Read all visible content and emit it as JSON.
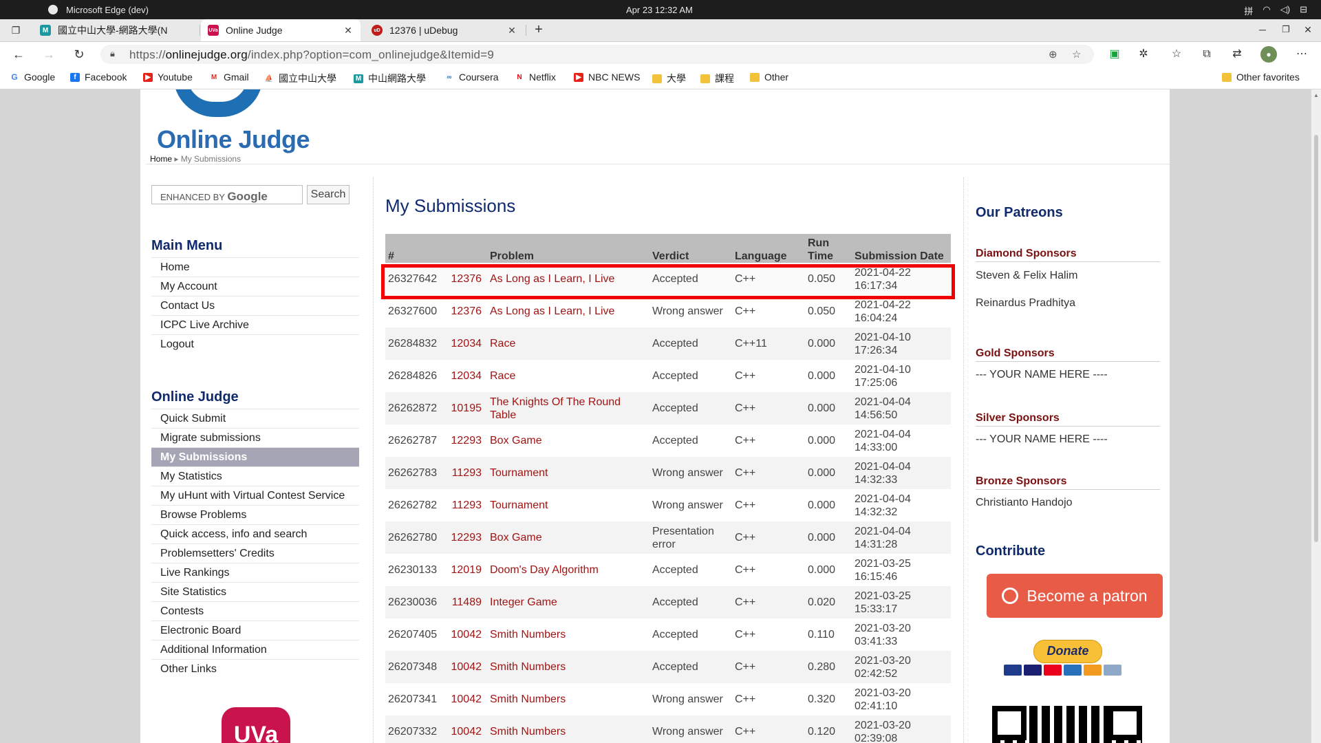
{
  "os": {
    "app": "Microsoft Edge (dev)",
    "clock": "Apr 23  12:32 AM",
    "ime": "拼"
  },
  "tabs": [
    {
      "title": "國立中山大學-網路大學(N",
      "favicon": "M"
    },
    {
      "title": "Online Judge",
      "favicon": "UVa"
    },
    {
      "title": "12376 | uDebug",
      "favicon": "uD"
    }
  ],
  "address": {
    "scheme": "https://",
    "host": "onlinejudge.org",
    "path": "/index.php?option=com_onlinejudge&Itemid=9"
  },
  "favorites": {
    "items": [
      "Google",
      "Facebook",
      "Youtube",
      "Gmail",
      "國立中山大學",
      "中山網路大學",
      "Coursera",
      "Netflix",
      "NBC NEWS",
      "大學",
      "課程",
      "Other"
    ],
    "other": "Other favorites"
  },
  "site": {
    "logo": "Online Judge",
    "breadcrumb": {
      "home": "Home",
      "current": "My Submissions"
    }
  },
  "search": {
    "placeholder": "ENHANCED BY",
    "google": "Google",
    "button": "Search"
  },
  "main_menu": {
    "title": "Main Menu",
    "items": [
      "Home",
      "My Account",
      "Contact Us",
      "ICPC Live Archive",
      "Logout"
    ]
  },
  "oj_menu": {
    "title": "Online Judge",
    "items": [
      "Quick Submit",
      "Migrate submissions",
      "My Submissions",
      "My Statistics",
      "My uHunt with Virtual Contest Service",
      "Browse Problems",
      "Quick access, info and search",
      "Problemsetters' Credits",
      "Live Rankings",
      "Site Statistics",
      "Contests",
      "Electronic Board",
      "Additional Information",
      "Other Links"
    ]
  },
  "uva_badge": "UVa",
  "submissions": {
    "title": "My Submissions",
    "headers": [
      "#",
      "",
      "Problem",
      "Verdict",
      "Language",
      "Run Time",
      "Submission Date"
    ],
    "rows": [
      [
        "26327642",
        "12376",
        "As Long as I Learn, I Live",
        "Accepted",
        "C++",
        "0.050",
        "2021-04-22 16:17:34"
      ],
      [
        "26327600",
        "12376",
        "As Long as I Learn, I Live",
        "Wrong answer",
        "C++",
        "0.050",
        "2021-04-22 16:04:24"
      ],
      [
        "26284832",
        "12034",
        "Race",
        "Accepted",
        "C++11",
        "0.000",
        "2021-04-10 17:26:34"
      ],
      [
        "26284826",
        "12034",
        "Race",
        "Accepted",
        "C++",
        "0.000",
        "2021-04-10 17:25:06"
      ],
      [
        "26262872",
        "10195",
        "The Knights Of The Round Table",
        "Accepted",
        "C++",
        "0.000",
        "2021-04-04 14:56:50"
      ],
      [
        "26262787",
        "12293",
        "Box Game",
        "Accepted",
        "C++",
        "0.000",
        "2021-04-04 14:33:00"
      ],
      [
        "26262783",
        "11293",
        "Tournament",
        "Wrong answer",
        "C++",
        "0.000",
        "2021-04-04 14:32:33"
      ],
      [
        "26262782",
        "11293",
        "Tournament",
        "Wrong answer",
        "C++",
        "0.000",
        "2021-04-04 14:32:32"
      ],
      [
        "26262780",
        "12293",
        "Box Game",
        "Presentation error",
        "C++",
        "0.000",
        "2021-04-04 14:31:28"
      ],
      [
        "26230133",
        "12019",
        "Doom's Day Algorithm",
        "Accepted",
        "C++",
        "0.000",
        "2021-03-25 16:15:46"
      ],
      [
        "26230036",
        "11489",
        "Integer Game",
        "Accepted",
        "C++",
        "0.020",
        "2021-03-25 15:33:17"
      ],
      [
        "26207405",
        "10042",
        "Smith Numbers",
        "Accepted",
        "C++",
        "0.110",
        "2021-03-20 03:41:33"
      ],
      [
        "26207348",
        "10042",
        "Smith Numbers",
        "Accepted",
        "C++",
        "0.280",
        "2021-03-20 02:42:52"
      ],
      [
        "26207341",
        "10042",
        "Smith Numbers",
        "Wrong answer",
        "C++",
        "0.320",
        "2021-03-20 02:41:10"
      ],
      [
        "26207332",
        "10042",
        "Smith Numbers",
        "Wrong answer",
        "C++",
        "0.120",
        "2021-03-20 02:39:08"
      ]
    ]
  },
  "patreons": {
    "title": "Our Patreons",
    "diamond": {
      "label": "Diamond Sponsors",
      "names": [
        "Steven & Felix Halim",
        "Reinardus Pradhitya"
      ]
    },
    "gold": {
      "label": "Gold Sponsors",
      "names": [
        "--- YOUR NAME HERE ----"
      ]
    },
    "silver": {
      "label": "Silver Sponsors",
      "names": [
        "--- YOUR NAME HERE ----"
      ]
    },
    "bronze": {
      "label": "Bronze Sponsors",
      "names": [
        "Christianto Handojo"
      ]
    }
  },
  "contribute": {
    "title": "Contribute",
    "patron_button": "Become a patron",
    "donate_button": "Donate"
  },
  "colors": {
    "link_red": "#a11414",
    "heading_blue": "#102a6e",
    "highlight": "#f00000",
    "patreon": "#e85b46"
  }
}
